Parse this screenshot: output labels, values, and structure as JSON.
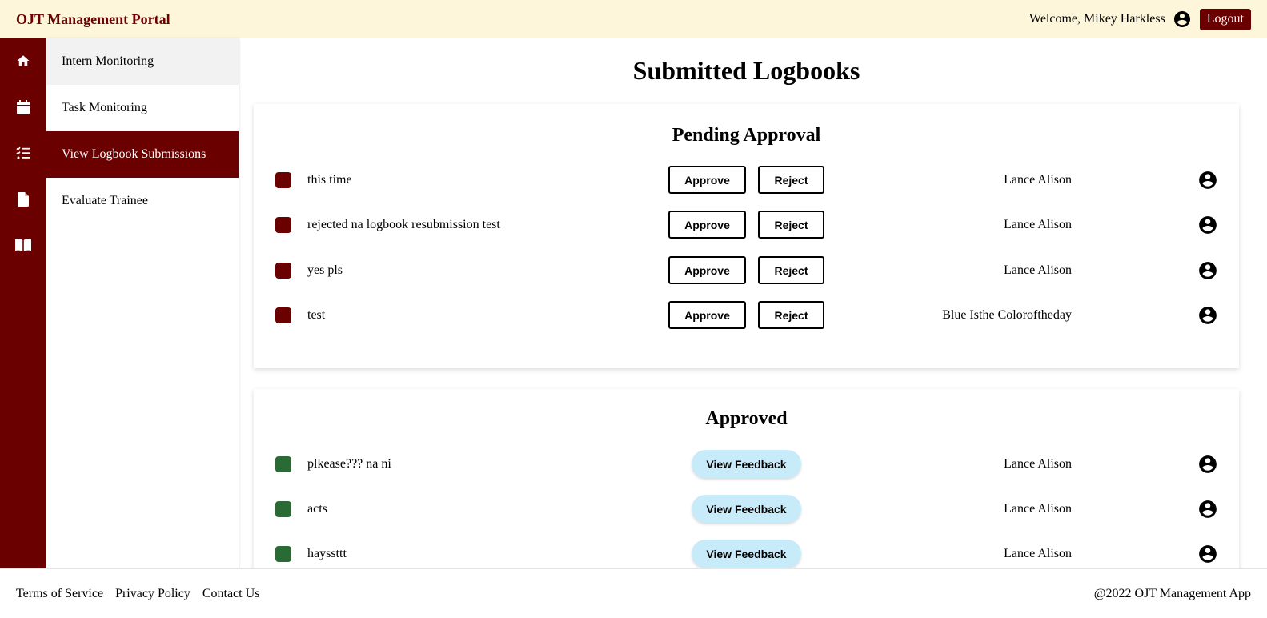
{
  "header": {
    "brand": "OJT Management Portal",
    "welcome": "Welcome, Mikey Harkless",
    "logout_label": "Logout",
    "account_icon": "account-circle-icon"
  },
  "rail": {
    "icons": [
      "home-icon",
      "calendar-icon",
      "checklist-icon",
      "document-icon",
      "book-icon"
    ]
  },
  "sidebar": {
    "items": [
      {
        "label": "Intern Monitoring",
        "state": "hover"
      },
      {
        "label": "Task Monitoring",
        "state": "normal"
      },
      {
        "label": "View Logbook Submissions",
        "state": "active"
      },
      {
        "label": "Evaluate Trainee",
        "state": "normal"
      }
    ]
  },
  "main": {
    "title": "Submitted Logbooks",
    "pending": {
      "title": "Pending Approval",
      "approve_label": "Approve",
      "reject_label": "Reject",
      "rows": [
        {
          "text": "this time",
          "name": "Lance Alison"
        },
        {
          "text": "rejected na logbook resubmission test",
          "name": "Lance Alison"
        },
        {
          "text": "yes pls",
          "name": "Lance Alison"
        },
        {
          "text": "test",
          "name": "Blue Isthe Coloroftheday"
        }
      ]
    },
    "approved": {
      "title": "Approved",
      "feedback_label": "View Feedback",
      "rows": [
        {
          "text": "plkease??? na ni",
          "name": "Lance Alison"
        },
        {
          "text": "acts",
          "name": "Lance Alison"
        },
        {
          "text": "hayssttt",
          "name": "Lance Alison"
        }
      ]
    }
  },
  "footer": {
    "links": [
      "Terms of Service",
      "Privacy Policy",
      "Contact Us"
    ],
    "copyright": "@2022 OJT Management App"
  },
  "colors": {
    "brand": "#6b0000",
    "header_bg": "#fef6da",
    "pending_status": "#6b0000",
    "approved_status": "#2a6b35",
    "feedback_button": "#c8ebfa"
  }
}
